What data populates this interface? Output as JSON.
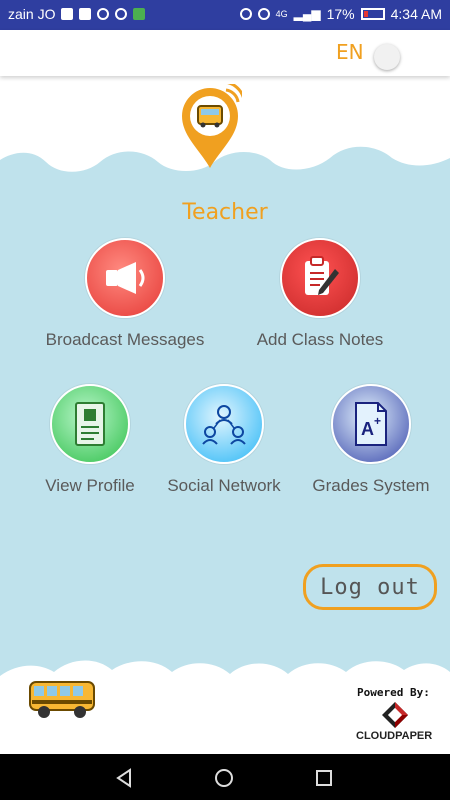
{
  "status_bar": {
    "carrier": "zain JO",
    "network": "4G",
    "battery": "17%",
    "time": "4:34 AM"
  },
  "header": {
    "language": "EN"
  },
  "role_title": "Teacher",
  "tiles": [
    {
      "label": "Broadcast Messages",
      "icon": "megaphone-icon",
      "color": "#e53935"
    },
    {
      "label": "Add Class Notes",
      "icon": "notes-pencil-icon",
      "color": "#d32f2f"
    },
    {
      "label": "View Profile",
      "icon": "profile-document-icon",
      "color": "#2fbf4a"
    },
    {
      "label": "Social Network",
      "icon": "people-network-icon",
      "color": "#29b6f6"
    },
    {
      "label": "Grades System",
      "icon": "grade-a-plus-icon",
      "color": "#3949ab"
    }
  ],
  "logout_label": "Log out",
  "footer": {
    "powered_by": "Powered By:",
    "company": "CLOUDPAPER"
  }
}
